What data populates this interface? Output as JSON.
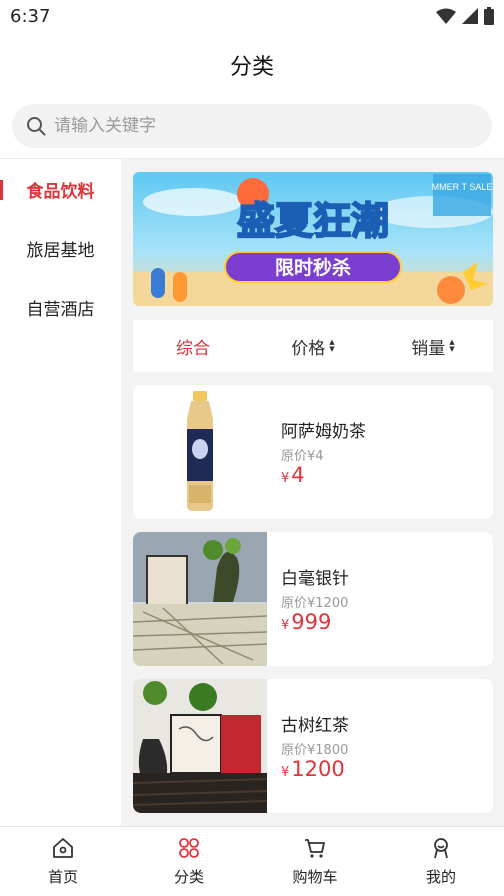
{
  "status": {
    "time": "6:37"
  },
  "header": {
    "title": "分类"
  },
  "search": {
    "placeholder": "请输入关键字"
  },
  "sidebar": {
    "items": [
      {
        "label": "食品饮料",
        "active": true
      },
      {
        "label": "旅居基地",
        "active": false
      },
      {
        "label": "自营酒店",
        "active": false
      }
    ]
  },
  "banner": {
    "headline": "盛夏狂潮",
    "subline": "限时秒杀",
    "corner_text": "MMER T SALE"
  },
  "sort": {
    "items": [
      {
        "label": "综合",
        "active": true
      },
      {
        "label": "价格",
        "active": false
      },
      {
        "label": "销量",
        "active": false
      }
    ]
  },
  "products": [
    {
      "name": "阿萨姆奶茶",
      "original": "原价¥4",
      "currency": "¥",
      "price": "4"
    },
    {
      "name": "白毫银针",
      "original": "原价¥1200",
      "currency": "¥",
      "price": "999"
    },
    {
      "name": "古树红茶",
      "original": "原价¥1800",
      "currency": "¥",
      "price": "1200"
    }
  ],
  "tabbar": {
    "items": [
      {
        "label": "首页",
        "icon": "home-icon"
      },
      {
        "label": "分类",
        "icon": "category-icon",
        "active": true
      },
      {
        "label": "购物车",
        "icon": "cart-icon"
      },
      {
        "label": "我的",
        "icon": "profile-icon"
      }
    ]
  },
  "colors": {
    "accent": "#e0333c",
    "background": "#f3f3f3"
  }
}
